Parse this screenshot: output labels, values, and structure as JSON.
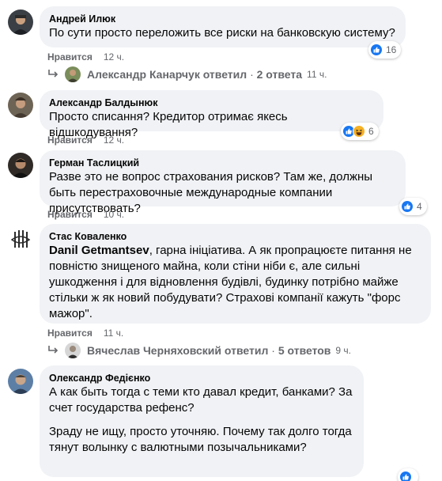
{
  "comments": [
    {
      "author": "Андрей Илюк",
      "text": "По сути просто переложить все риски на банковскую систему?",
      "like_label": "Нравится",
      "time": "12 ч.",
      "reactions": {
        "count": "16",
        "icons": [
          "like-icon"
        ]
      },
      "replies": {
        "name": "Александр Канарчук",
        "verb": "ответил",
        "sep": "·",
        "count": "2 ответа",
        "time": "11 ч."
      }
    },
    {
      "author": "Александр Балдынюк",
      "text": "Просто списання? Кредитор отримає якесь відшкодування?",
      "like_label": "Нравится",
      "time": "12 ч.",
      "reactions": {
        "count": "6",
        "icons": [
          "like-icon",
          "haha-icon"
        ]
      }
    },
    {
      "author": "Герман Таслицкий",
      "text": "Разве это не вопрос страхования рисков? Там же, должны быть перестраховочные международные компании присутствовать?",
      "like_label": "Нравится",
      "time": "10 ч.",
      "reactions": {
        "count": "4",
        "icons": [
          "like-icon"
        ]
      }
    },
    {
      "author": "Стас Коваленко",
      "mention": "Danil Getmantsev",
      "text": ", гарна ініціатива. А як пропрацюєте питання не повністю знищеного майна, коли стіни ніби є, але сильні ушкодження і для відновлення будівлі, будинку потрібно майже стільки ж як новий побудувати? Страхові компанії кажуть \"форс мажор\".",
      "like_label": "Нравится",
      "time": "11 ч.",
      "replies": {
        "name": "Вячеслав Черняховский",
        "verb": "ответил",
        "sep": "·",
        "count": "5 ответов",
        "time": "9 ч."
      }
    },
    {
      "author": "Олександр Федієнко",
      "paragraphs": [
        "А как быть тогда с теми кто давал кредит, банками? За счет государства рефенс?",
        "Зраду не ищу, просто уточняю. Почему так долго тогда тянут волынку с валютными позычальниками?"
      ],
      "reactions": {
        "count": "",
        "icons": [
          "like-icon"
        ]
      }
    }
  ],
  "colors": {
    "bubble": "#f0f2f5",
    "meta": "#65676b",
    "like_blue": "#1877f2",
    "haha_yellow": "#f7b125"
  }
}
